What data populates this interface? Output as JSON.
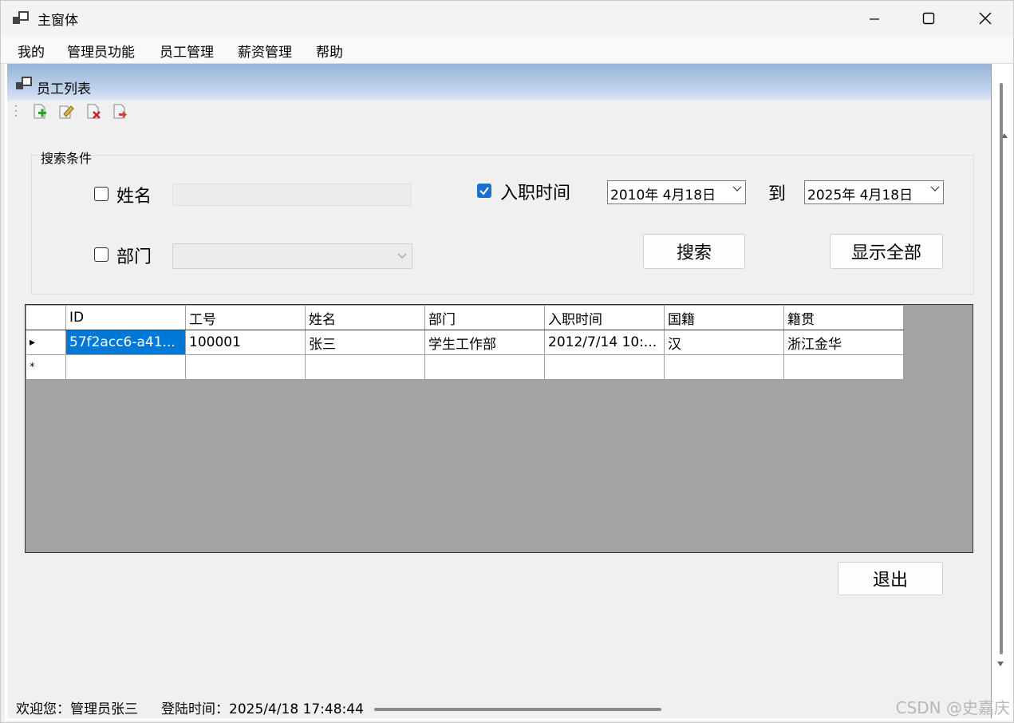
{
  "window": {
    "title": "主窗体"
  },
  "menu": {
    "items": [
      "我的",
      "管理员功能",
      "员工管理",
      "薪资管理",
      "帮助"
    ]
  },
  "child_window": {
    "title": "员工列表"
  },
  "toolbar": {
    "buttons": [
      "add-icon",
      "edit-icon",
      "delete-icon",
      "export-icon"
    ]
  },
  "search": {
    "group_title": "搜索条件",
    "name_label": "姓名",
    "name_checked": false,
    "name_value": "",
    "dept_label": "部门",
    "dept_checked": false,
    "dept_value": "",
    "hire_label": "入职时间",
    "hire_checked": true,
    "date_from": "2010年  4月18日",
    "to_label": "到",
    "date_to": "2025年  4月18日",
    "search_button": "搜索",
    "show_all_button": "显示全部"
  },
  "grid": {
    "columns": [
      "ID",
      "工号",
      "姓名",
      "部门",
      "入职时间",
      "国籍",
      "籍贯"
    ],
    "rows": [
      [
        "57f2acc6-a41...",
        "100001",
        "张三",
        "学生工作部",
        "2012/7/14 10:...",
        "汉",
        "浙江金华"
      ]
    ],
    "current_row_marker": "▸",
    "new_row_marker": "*"
  },
  "exit_button": "退出",
  "status": {
    "welcome": "欢迎您：管理员张三",
    "login_time": "登陆时间：2025/4/18 17:48:44"
  },
  "watermark": "CSDN @史嘉庆",
  "colors": {
    "selection": "#0078d7",
    "title_gradient_top": "#97b3d8",
    "grid_background": "#a3a3a3",
    "checkbox_checked": "#1a6fd1"
  }
}
